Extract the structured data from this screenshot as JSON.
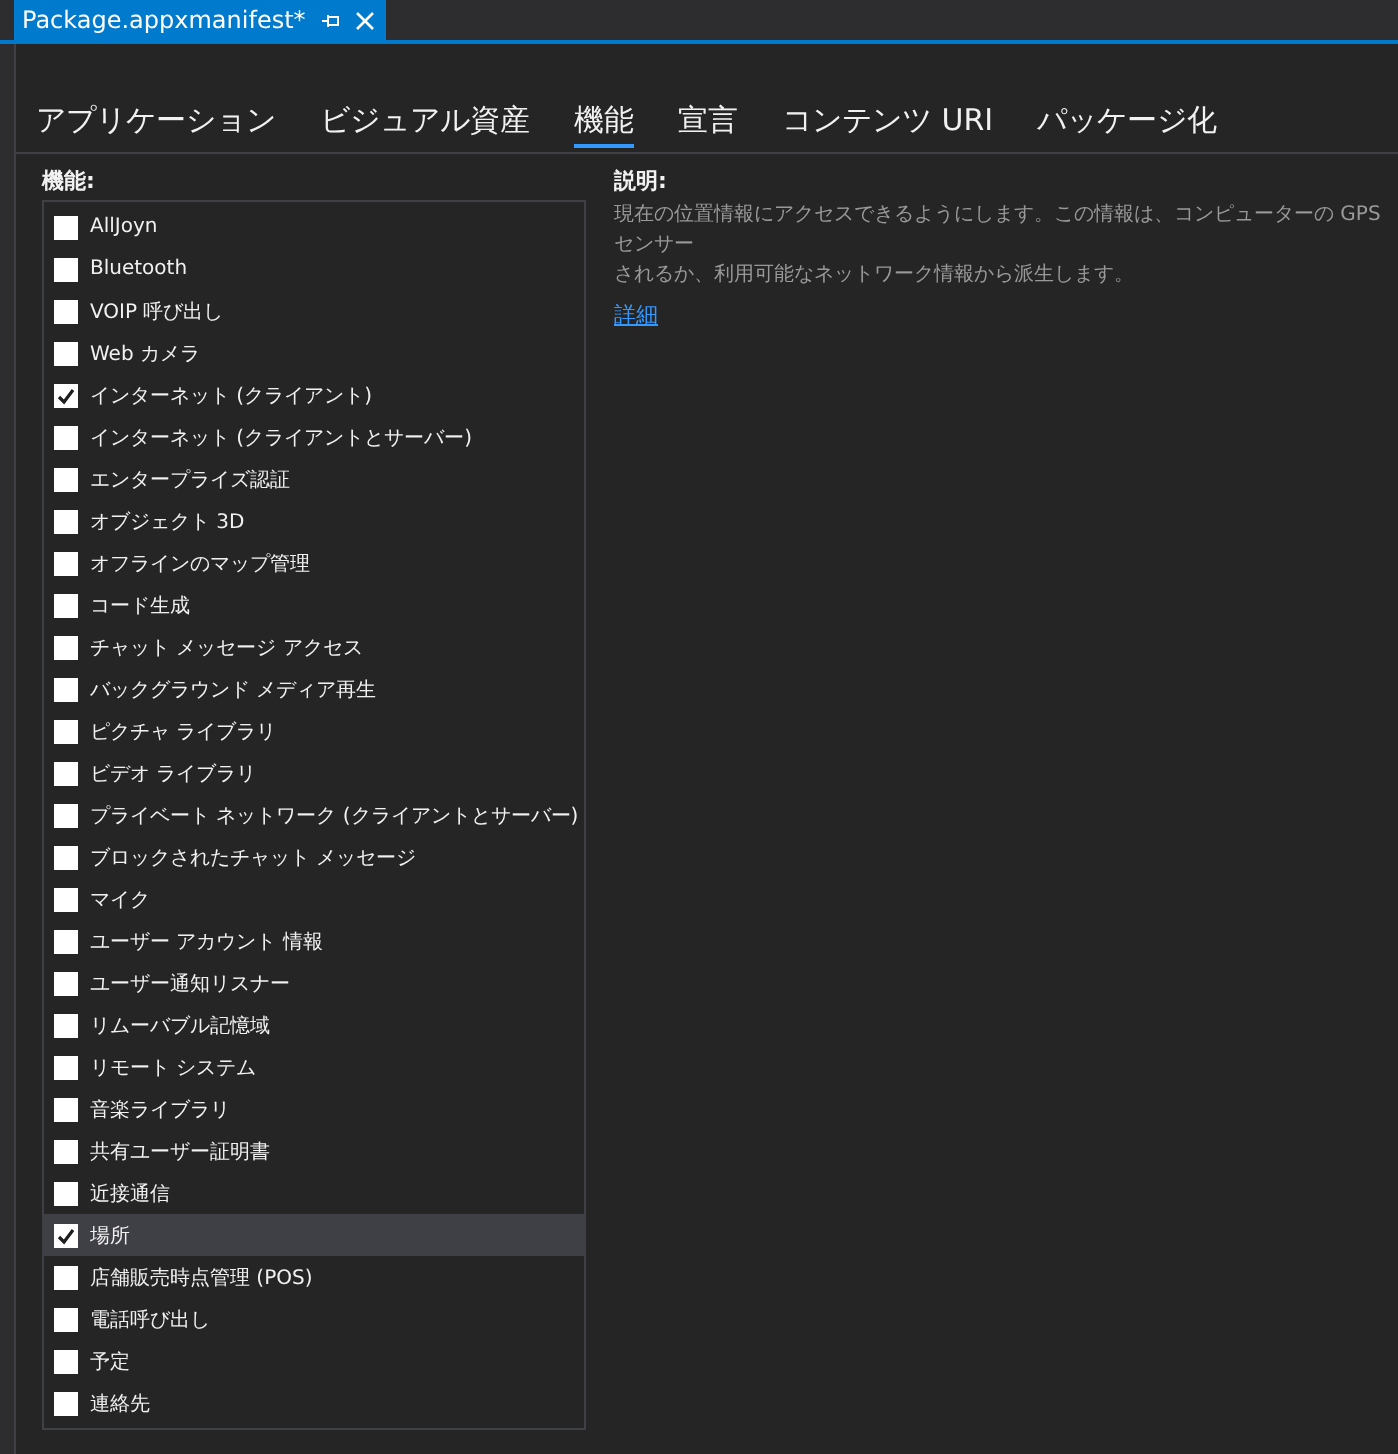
{
  "document_tab": {
    "title": "Package.appxmanifest*"
  },
  "tabs": [
    {
      "label": "アプリケーション",
      "selected": false
    },
    {
      "label": "ビジュアル資産",
      "selected": false
    },
    {
      "label": "機能",
      "selected": true
    },
    {
      "label": "宣言",
      "selected": false
    },
    {
      "label": "コンテンツ URI",
      "selected": false
    },
    {
      "label": "パッケージ化",
      "selected": false
    }
  ],
  "capabilities": {
    "heading": "機能:",
    "items": [
      {
        "label": "AllJoyn",
        "checked": false,
        "selected": false
      },
      {
        "label": "Bluetooth",
        "checked": false,
        "selected": false
      },
      {
        "label": "VOIP 呼び出し",
        "checked": false,
        "selected": false
      },
      {
        "label": "Web カメラ",
        "checked": false,
        "selected": false
      },
      {
        "label": "インターネット (クライアント)",
        "checked": true,
        "selected": false
      },
      {
        "label": "インターネット (クライアントとサーバー)",
        "checked": false,
        "selected": false
      },
      {
        "label": "エンタープライズ認証",
        "checked": false,
        "selected": false
      },
      {
        "label": "オブジェクト 3D",
        "checked": false,
        "selected": false
      },
      {
        "label": "オフラインのマップ管理",
        "checked": false,
        "selected": false
      },
      {
        "label": "コード生成",
        "checked": false,
        "selected": false
      },
      {
        "label": "チャット メッセージ アクセス",
        "checked": false,
        "selected": false
      },
      {
        "label": "バックグラウンド メディア再生",
        "checked": false,
        "selected": false
      },
      {
        "label": "ピクチャ ライブラリ",
        "checked": false,
        "selected": false
      },
      {
        "label": "ビデオ ライブラリ",
        "checked": false,
        "selected": false
      },
      {
        "label": "プライベート ネットワーク (クライアントとサーバー)",
        "checked": false,
        "selected": false
      },
      {
        "label": "ブロックされたチャット メッセージ",
        "checked": false,
        "selected": false
      },
      {
        "label": "マイク",
        "checked": false,
        "selected": false
      },
      {
        "label": "ユーザー アカウント 情報",
        "checked": false,
        "selected": false
      },
      {
        "label": "ユーザー通知リスナー",
        "checked": false,
        "selected": false
      },
      {
        "label": "リムーバブル記憶域",
        "checked": false,
        "selected": false
      },
      {
        "label": "リモート システム",
        "checked": false,
        "selected": false
      },
      {
        "label": "音楽ライブラリ",
        "checked": false,
        "selected": false
      },
      {
        "label": "共有ユーザー証明書",
        "checked": false,
        "selected": false
      },
      {
        "label": "近接通信",
        "checked": false,
        "selected": false
      },
      {
        "label": "場所",
        "checked": true,
        "selected": true
      },
      {
        "label": "店舗販売時点管理 (POS)",
        "checked": false,
        "selected": false
      },
      {
        "label": "電話呼び出し",
        "checked": false,
        "selected": false
      },
      {
        "label": "予定",
        "checked": false,
        "selected": false
      },
      {
        "label": "連絡先",
        "checked": false,
        "selected": false
      }
    ]
  },
  "description": {
    "heading": "説明:",
    "lines": [
      "現在の位置情報にアクセスできるようにします。この情報は、コンピューターの GPS センサー",
      "されるか、利用可能なネットワーク情報から派生します。"
    ],
    "link": "詳細"
  }
}
